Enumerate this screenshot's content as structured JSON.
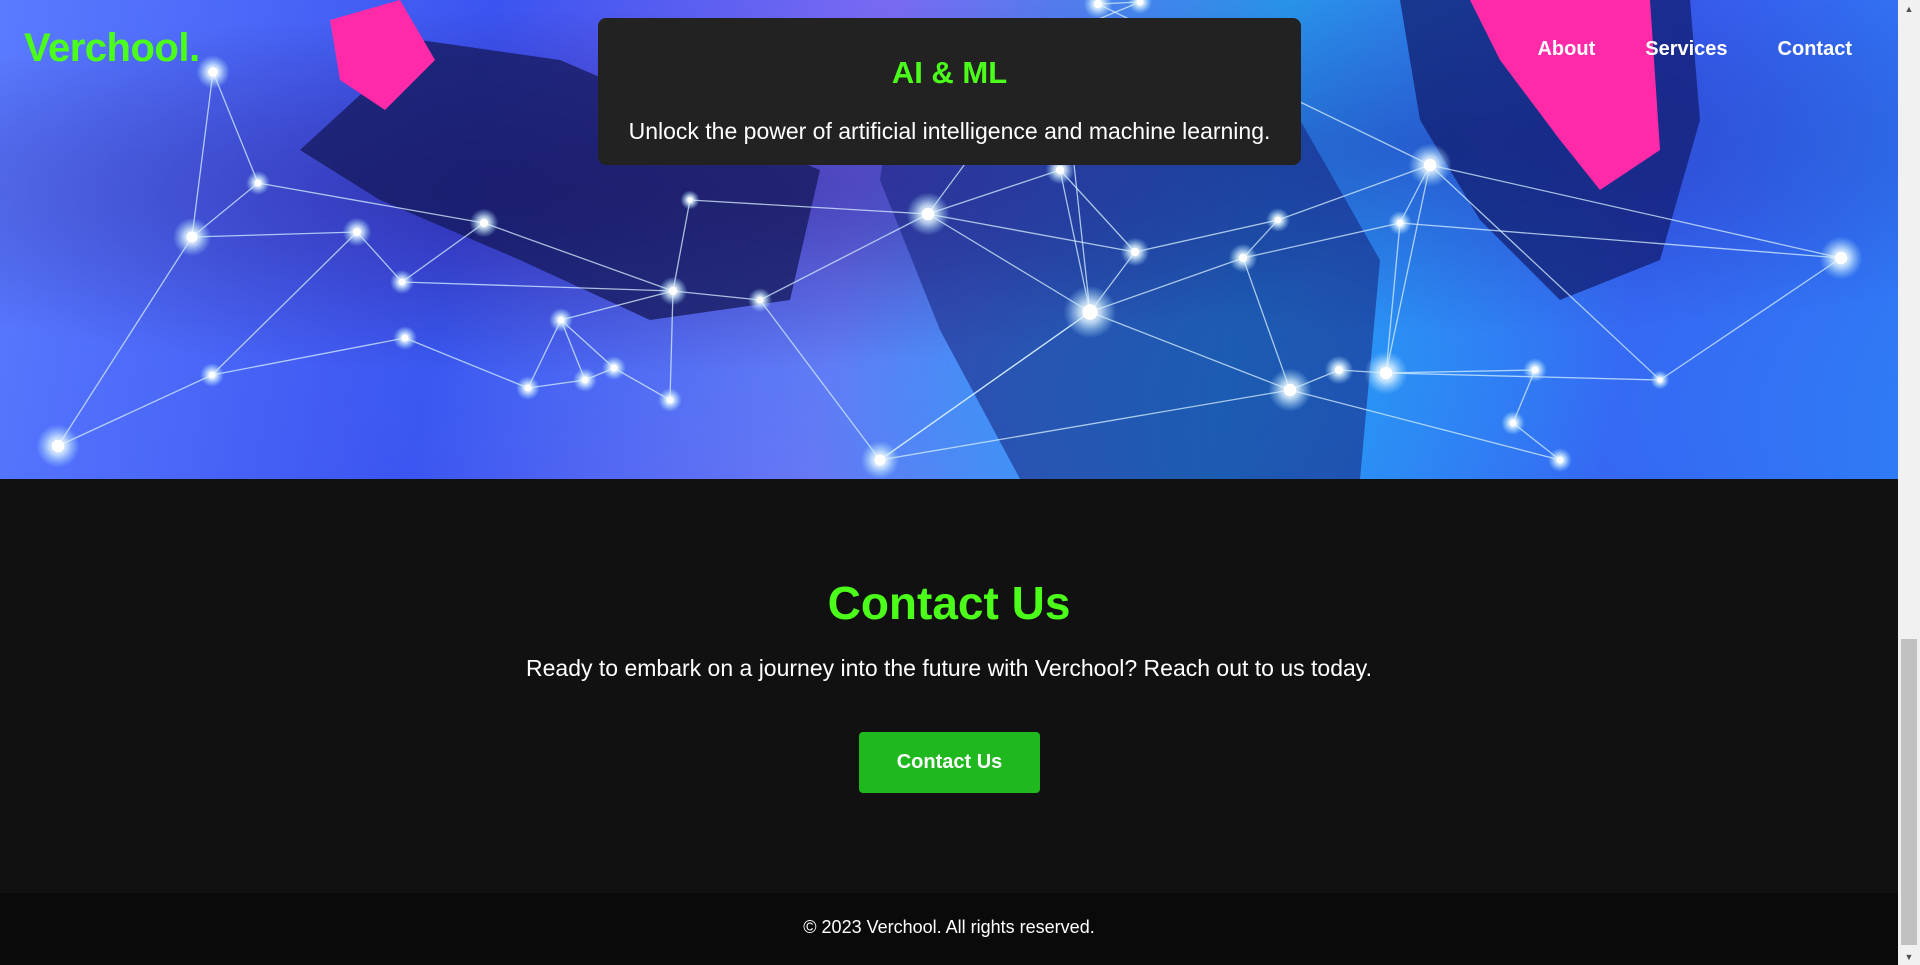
{
  "brand": {
    "logo": "Verchool."
  },
  "nav": {
    "items": [
      "About",
      "Services",
      "Contact"
    ]
  },
  "feature_card": {
    "title": "AI & ML",
    "description": "Unlock the power of artificial intelligence and machine learning."
  },
  "contact": {
    "heading": "Contact Us",
    "text": "Ready to embark on a journey into the future with Verchool? Reach out to us today.",
    "button_label": "Contact Us"
  },
  "footer": {
    "copyright": "© 2023 Verchool. All rights reserved."
  },
  "scrollbar": {
    "up_icon": "triangle-up",
    "down_icon": "triangle-down"
  },
  "colors": {
    "accent": "#4cff1a",
    "button": "#1fb81f",
    "background": "#111111",
    "card": "#222222",
    "footer": "#0a0a0a"
  }
}
